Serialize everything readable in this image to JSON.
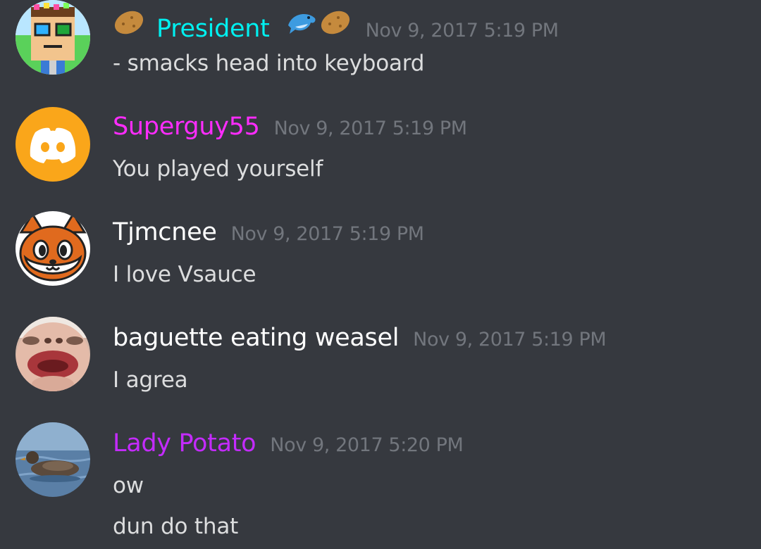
{
  "messages": [
    {
      "author": "President",
      "author_color": "#00f0f0",
      "badges_before": [
        "potato-icon"
      ],
      "badges_after": [
        "dolphin-icon",
        "potato-icon"
      ],
      "timestamp": "Nov 9, 2017 5:19 PM",
      "lines": [
        "- smacks head into keyboard"
      ],
      "avatar": "pixel-character-avatar"
    },
    {
      "author": "Superguy55",
      "author_color": "#ff2cff",
      "timestamp": "Nov 9, 2017 5:19 PM",
      "lines": [
        "You played yourself"
      ],
      "avatar": "discord-default-avatar"
    },
    {
      "author": "Tjmcnee",
      "author_color": "#ffffff",
      "timestamp": "Nov 9, 2017 5:19 PM",
      "lines": [
        "I love Vsauce"
      ],
      "avatar": "fox-avatar"
    },
    {
      "author": "baguette eating weasel",
      "author_color": "#ffffff",
      "timestamp": "Nov 9, 2017 5:19 PM",
      "lines": [
        "I agrea"
      ],
      "avatar": "face-photo-avatar"
    },
    {
      "author": "Lady Potato",
      "author_color": "#c42bff",
      "timestamp": "Nov 9, 2017 5:20 PM",
      "lines": [
        "ow",
        "dun do that"
      ],
      "avatar": "duck-photo-avatar"
    }
  ],
  "colors": {
    "background": "#36393f",
    "timestamp": "#72767d",
    "text": "#dcddde"
  }
}
